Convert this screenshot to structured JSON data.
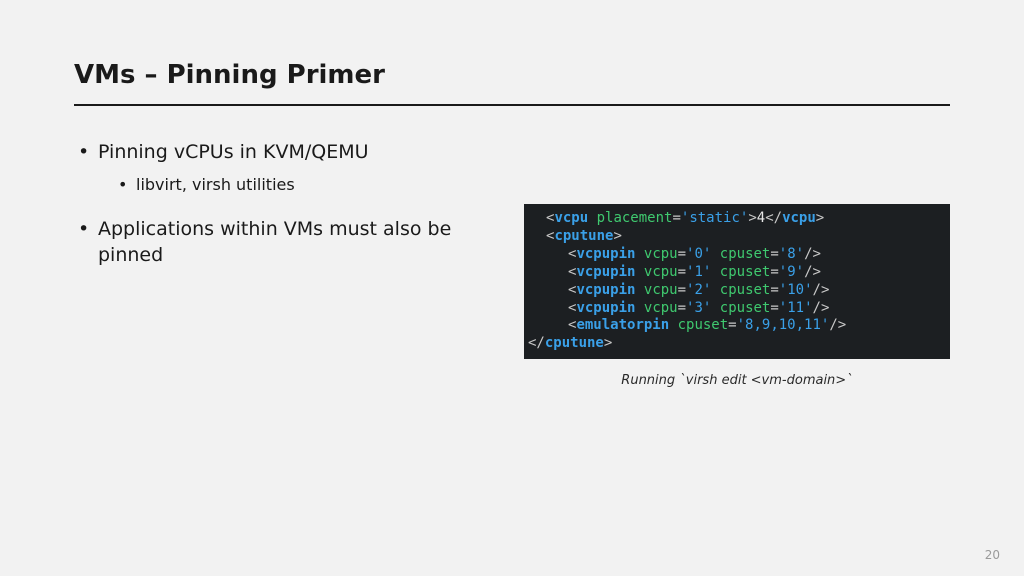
{
  "title": "VMs – Pinning Primer",
  "bullets": {
    "b1": "Pinning vCPUs in KVM/QEMU",
    "b1_sub1": "libvirt, virsh utilities",
    "b2": "Applications within VMs must also be pinned"
  },
  "code": {
    "vcpu_tag": "vcpu",
    "placement_attr": "placement",
    "placement_val": "'static'",
    "vcpu_count": "4",
    "cputune_tag": "cputune",
    "vcpupin_tag": "vcpupin",
    "vcpu_attr": "vcpu",
    "cpuset_attr": "cpuset",
    "pin0_vcpu": "'0'",
    "pin0_set": "'8'",
    "pin1_vcpu": "'1'",
    "pin1_set": "'9'",
    "pin2_vcpu": "'2'",
    "pin2_set": "'10'",
    "pin3_vcpu": "'3'",
    "pin3_set": "'11'",
    "emul_tag": "emulatorpin",
    "emul_set": "'8,9,10,11'"
  },
  "caption": "Running `virsh edit <vm-domain>`",
  "page": "20"
}
